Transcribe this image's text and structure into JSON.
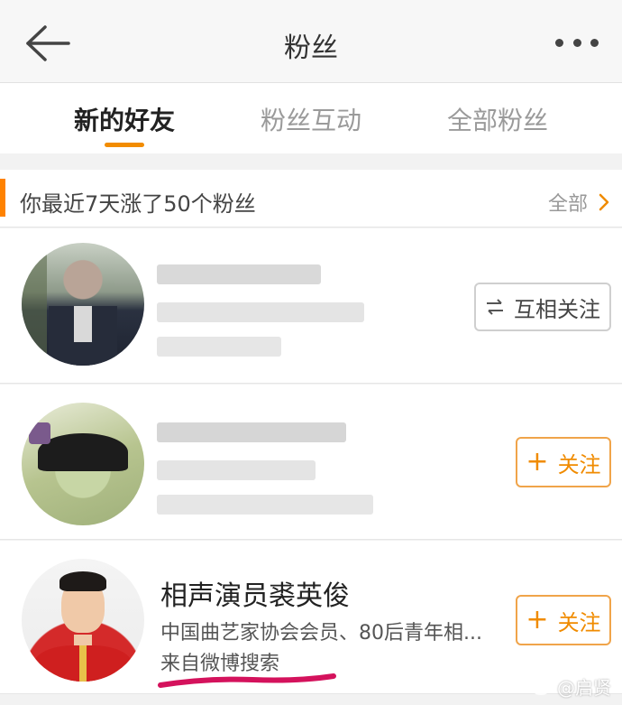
{
  "nav": {
    "title": "粉丝",
    "back_icon": "back-arrow-icon",
    "more_icon": "more-dots-icon"
  },
  "tabs": [
    {
      "label": "新的好友",
      "active": true
    },
    {
      "label": "粉丝互动",
      "active": false
    },
    {
      "label": "全部粉丝",
      "active": false
    }
  ],
  "summary": {
    "text": "你最近7天涨了50个粉丝",
    "all_label": "全部",
    "accent_color": "#ff8200"
  },
  "fans": [
    {
      "name": "",
      "blurred": true,
      "button": {
        "icon": "swap-arrows-icon",
        "label": "互相关注"
      }
    },
    {
      "name": "",
      "blurred": true,
      "button": {
        "icon": "plus-icon",
        "label": "关注"
      }
    },
    {
      "name": "相声演员裘英俊",
      "description": "中国曲艺家协会会员、80后青年相...",
      "source": "来自微博搜索",
      "blurred": false,
      "button": {
        "icon": "plus-icon",
        "label": "关注"
      }
    }
  ],
  "watermark": {
    "text": "@启贤"
  },
  "colors": {
    "brand_orange": "#f08b00",
    "highlight_underline": "#d4125c"
  }
}
